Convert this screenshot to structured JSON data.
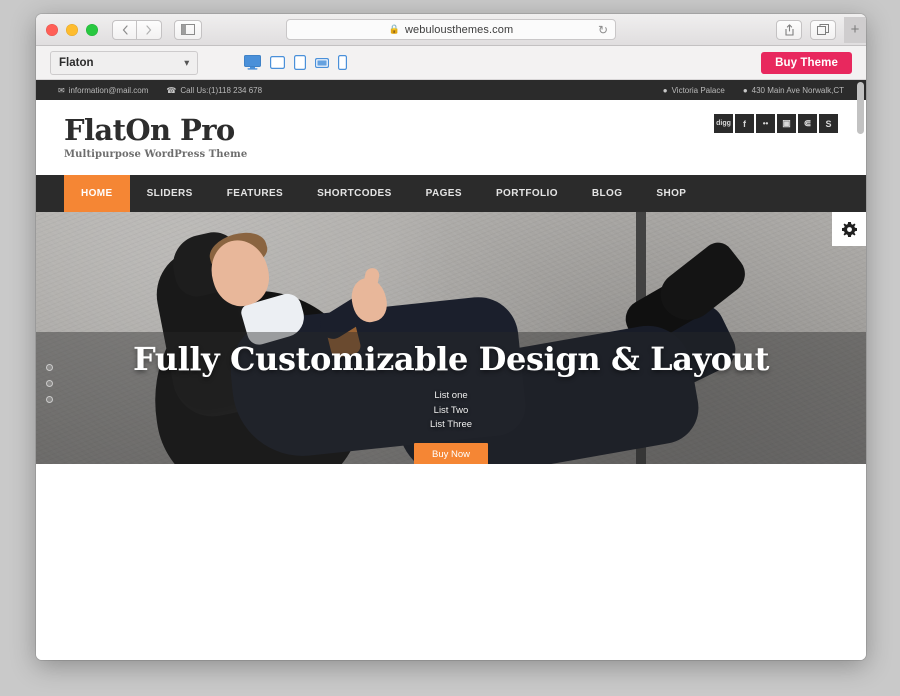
{
  "browser": {
    "url": "webulousthemes.com",
    "lock_icon": "lock-icon",
    "reload_icon": "reload-icon",
    "back_icon": "chevron-left-icon",
    "forward_icon": "chevron-right-icon",
    "sidebar_icon": "sidebar-icon",
    "share_icon": "share-icon",
    "tabs_icon": "tabs-icon",
    "new_tab_label": "+"
  },
  "preview_bar": {
    "theme_name": "Flaton",
    "chevron": "⌄",
    "devices": [
      {
        "name": "desktop",
        "label": "Desktop",
        "active": true
      },
      {
        "name": "tablet-landscape",
        "label": "Tablet Landscape",
        "active": false
      },
      {
        "name": "tablet-portrait",
        "label": "Tablet Portrait",
        "active": false
      },
      {
        "name": "mobile-landscape",
        "label": "Mobile Landscape",
        "active": false
      },
      {
        "name": "mobile-portrait",
        "label": "Mobile Portrait",
        "active": false
      }
    ],
    "buy_theme_label": "Buy Theme",
    "buy_theme_color": "#e8285e",
    "device_icon_color": "#4a90d9"
  },
  "site": {
    "topbar": {
      "email": "information@mail.com",
      "phone": "Call Us:(1)118 234 678",
      "location_name": "Victoria Palace",
      "address": "430 Main Ave Norwalk,CT"
    },
    "logo": {
      "title": "FlatOn Pro",
      "tagline": "Multipurpose WordPress Theme"
    },
    "social": [
      {
        "name": "digg-icon",
        "label": "digg"
      },
      {
        "name": "facebook-icon",
        "label": "f"
      },
      {
        "name": "flickr-icon",
        "label": "••"
      },
      {
        "name": "instagram-icon",
        "label": "▣"
      },
      {
        "name": "rss-icon",
        "label": "⋐"
      },
      {
        "name": "skype-icon",
        "label": "S"
      }
    ],
    "nav": [
      {
        "label": "HOME",
        "active": true
      },
      {
        "label": "SLIDERS",
        "active": false
      },
      {
        "label": "FEATURES",
        "active": false
      },
      {
        "label": "SHORTCODES",
        "active": false
      },
      {
        "label": "PAGES",
        "active": false
      },
      {
        "label": "PORTFOLIO",
        "active": false
      },
      {
        "label": "BLOG",
        "active": false
      },
      {
        "label": "SHOP",
        "active": false
      }
    ],
    "nav_active_color": "#f58634",
    "hero": {
      "title": "Fully Customizable Design & Layout",
      "list": [
        "List one",
        "List Two",
        "List Three"
      ],
      "button_label": "Buy Now",
      "button_color": "#f58634",
      "settings_icon": "gear-icon",
      "bullet_count": 3
    }
  }
}
